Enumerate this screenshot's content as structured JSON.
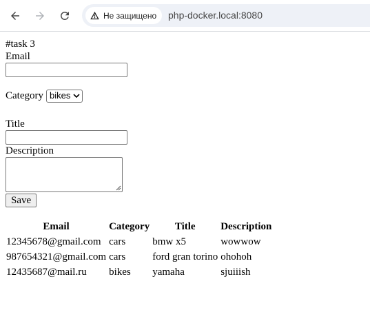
{
  "browser": {
    "security_label": "Не защищено",
    "url": "php-docker.local:8080"
  },
  "page": {
    "heading": "#task 3",
    "email_label": "Email",
    "email_value": "",
    "category_label": "Category",
    "category_selected": "bikes",
    "title_label": "Title",
    "title_value": "",
    "description_label": "Description",
    "save_label": "Save"
  },
  "table": {
    "headers": [
      "Email",
      "Category",
      "Title",
      "Description"
    ],
    "rows": [
      [
        "12345678@gmail.com",
        "cars",
        "bmw x5",
        "wowwow"
      ],
      [
        "987654321@gmail.com",
        "cars",
        "ford gran torino",
        "ohohoh"
      ],
      [
        "12435687@mail.ru",
        "bikes",
        "yamaha",
        "sjuiiish"
      ]
    ]
  }
}
